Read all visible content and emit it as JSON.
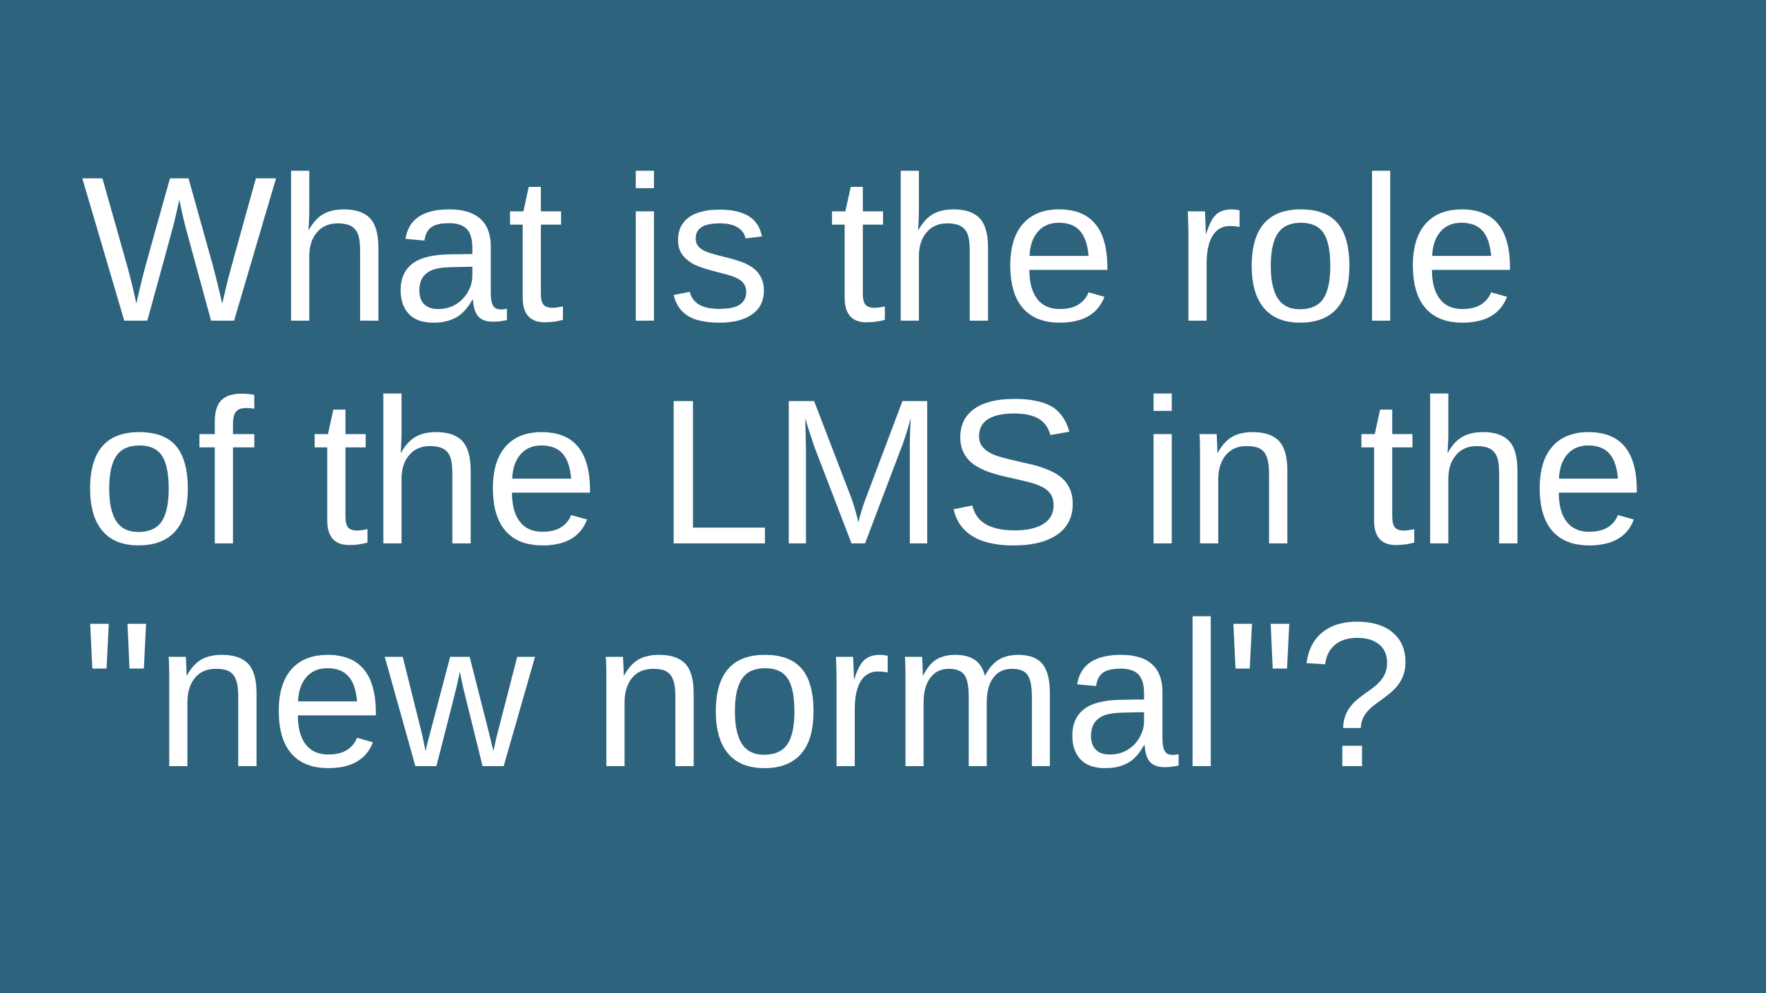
{
  "slide": {
    "background_color": "#2e637e",
    "text_color": "#ffffff",
    "title_lines": [
      "What is the role",
      "of the LMS in the",
      "\"new normal\"?"
    ]
  }
}
